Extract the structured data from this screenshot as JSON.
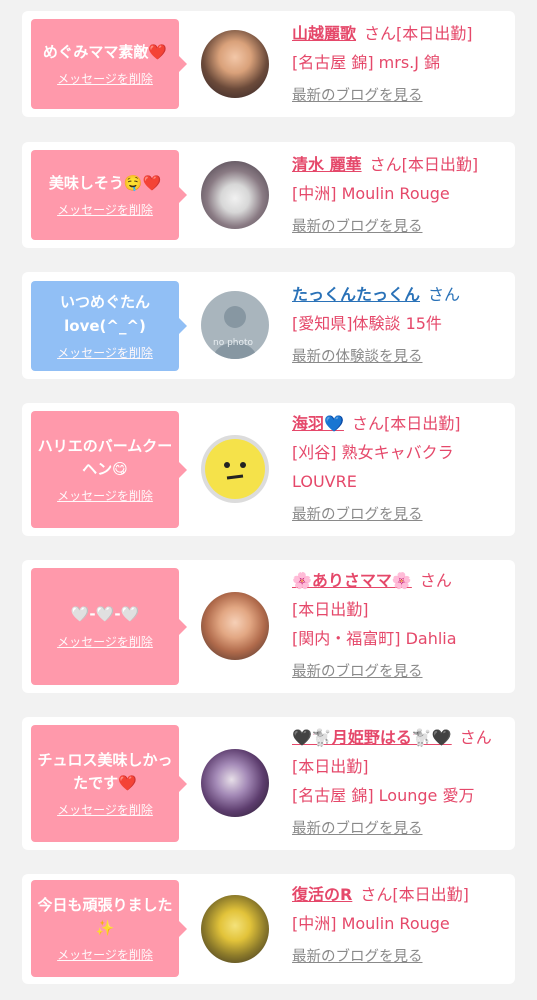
{
  "delete_label": "メッセージを削除",
  "cards": [
    {
      "message": "めぐみママ素敵❤️",
      "name": "山越麗歌",
      "san": "さん",
      "status": "[本日出勤]",
      "shop": "[名古屋 錦] mrs.J 錦",
      "link": "最新のブログを見る"
    },
    {
      "message": "美味しそう🤤❤️",
      "name": "清水 麗華",
      "san": "さん",
      "status": "[本日出勤]",
      "shop": "[中洲] Moulin Rouge",
      "link": "最新のブログを見る"
    },
    {
      "message": "いつめぐたんlove(^_^)",
      "name": "たっくんたっくん",
      "san": "さん",
      "status": "",
      "shop": "[愛知県]体験談 15件",
      "link": "最新の体験談を見る",
      "avatar_text": "no photo"
    },
    {
      "message": "ハリエのバームクーヘン😋",
      "name": "海羽💙",
      "san": "さん",
      "status": "[本日出勤]",
      "shop": "[刈谷] 熟女キャバクラ LOUVRE",
      "link": "最新のブログを見る"
    },
    {
      "message": "🤍-🤍-🤍",
      "name": "🌸ありさママ🌸",
      "san": "さん",
      "status": "[本日出勤]",
      "shop": "[関内・福富町] Dahlia",
      "link": "最新のブログを見る"
    },
    {
      "message": "チュロス美味しかったです❤️",
      "name": "🖤🐩月姫野はる🐩🖤",
      "san": "さん",
      "status": "[本日出勤]",
      "shop": "[名古屋 錦] Lounge 愛万",
      "link": "最新のブログを見る"
    },
    {
      "message": "今日も頑張りました✨",
      "name": "復活のR",
      "san": "さん",
      "status": "[本日出勤]",
      "shop": "[中洲] Moulin Rouge",
      "link": "最新のブログを見る"
    }
  ]
}
